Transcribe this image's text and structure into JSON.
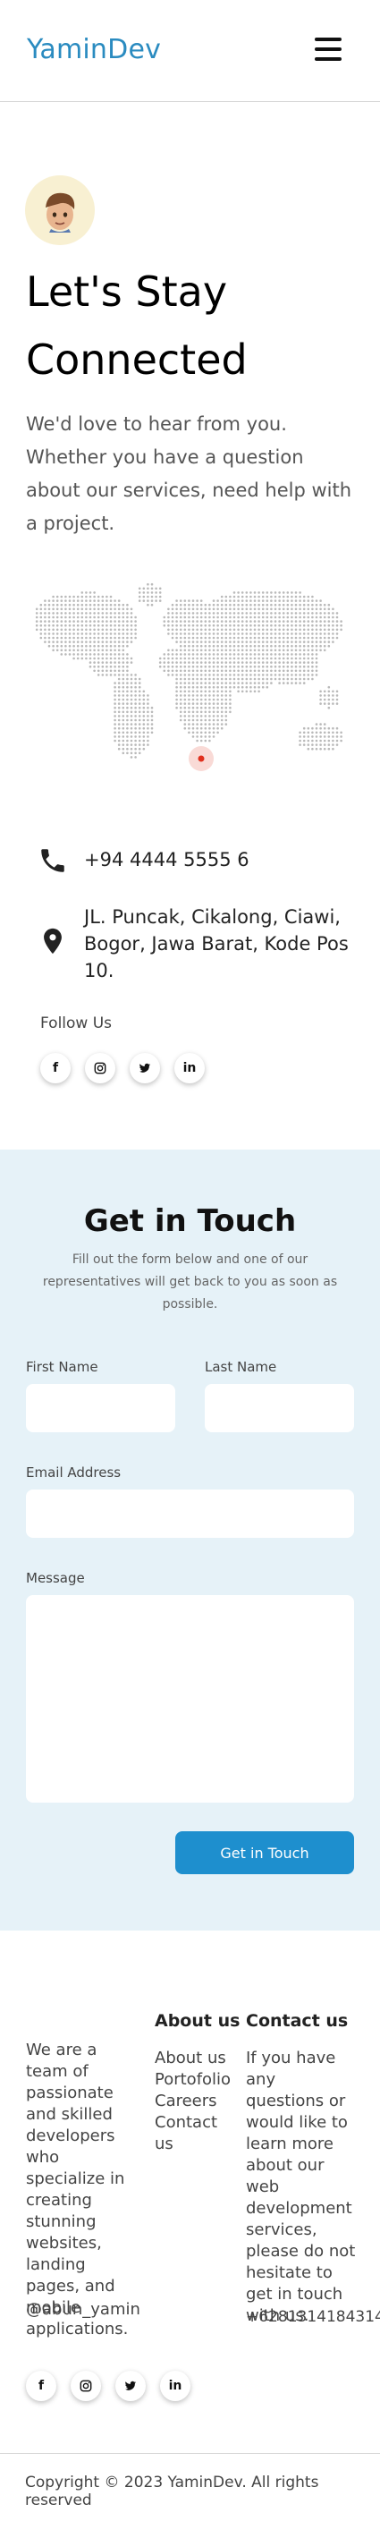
{
  "header": {
    "logo": "YaminDev",
    "menu_icon": "hamburger-menu-icon"
  },
  "hero": {
    "avatar_icon": "memoji-avatar-icon",
    "title": "Let's Stay Connected",
    "description": "We'd love to hear from you. Whether you have a question about our services, need help with a project."
  },
  "map": {
    "icon": "dotted-world-map",
    "marker_color": "#e0301e"
  },
  "contact": {
    "phone_icon": "phone-icon",
    "phone": "+94 4444 5555 6",
    "address_icon": "location-pin-icon",
    "address": "JL. Puncak, Cikalong, Ciawi, Bogor, Jawa Barat, Kode Pos 10."
  },
  "follow": {
    "label": "Follow Us",
    "socials": [
      {
        "icon": "facebook-icon",
        "glyph": "f"
      },
      {
        "icon": "instagram-icon"
      },
      {
        "icon": "twitter-icon"
      },
      {
        "icon": "linkedin-icon",
        "glyph": "in"
      }
    ]
  },
  "form": {
    "title": "Get in Touch",
    "subtitle": "Fill out the form below and one of our representatives will get back to you as soon as possible.",
    "first_name_label": "First Name",
    "first_name_value": "",
    "last_name_label": "Last Name",
    "last_name_value": "",
    "email_label": "Email Address",
    "email_value": "",
    "message_label": "Message",
    "message_value": "",
    "submit_label": "Get in Touch"
  },
  "footer": {
    "about_text": "We are a team of passionate and skilled developers who specialize in creating stunning websites, landing pages, and mobile applications.",
    "handle": "@abun_yamin",
    "about_heading": "About us",
    "about_links": [
      "About us",
      "Portofolio",
      "Careers",
      "Contact us"
    ],
    "contact_heading": "Contact us",
    "contact_text": "If you have any questions or would like to learn more about our web development services, please do not hesitate to get in touch with us.",
    "contact_phone": "+6281314184314",
    "copyright": "Copyright © 2023 YaminDev. All rights reserved"
  },
  "colors": {
    "brand": "#2a8bc0",
    "button": "#1e8fce",
    "form_bg": "#e6f2f8"
  }
}
